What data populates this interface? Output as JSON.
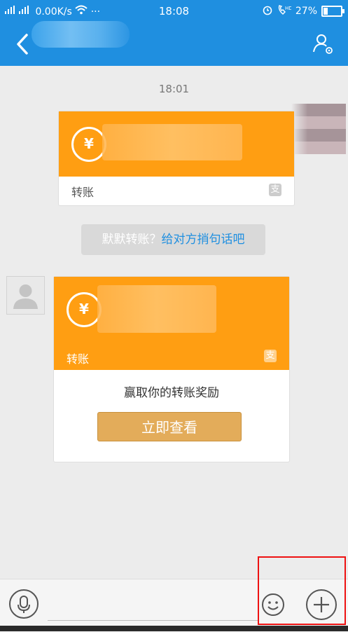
{
  "status_bar": {
    "network": "4G 2G",
    "speed": "0.00K/s",
    "time": "18:08",
    "battery_percent": "27%",
    "battery_level": 0.27
  },
  "chat": {
    "timestamp": "18:01",
    "sent_transfer": {
      "label": "转账",
      "coin_glyph": "¥"
    },
    "system_hint": {
      "prefix": "默默转账？",
      "link": "给对方捎句话吧"
    },
    "received_transfer": {
      "label": "转账",
      "coin_glyph": "¥",
      "reward_text": "赢取你的转账奖励",
      "button_label": "立即查看"
    }
  },
  "icons": {
    "back": "back-arrow-icon",
    "profile": "profile-settings-icon",
    "alipay": "alipay-logo-icon",
    "mic": "microphone-icon",
    "emoji": "emoji-icon",
    "plus": "plus-icon",
    "alarm": "alarm-icon",
    "call": "hd-call-icon",
    "wifi": "wifi-icon"
  },
  "colors": {
    "header": "#1f8fe0",
    "transfer_orange": "#ff9e12",
    "button_gold": "#e3ac5a",
    "link_blue": "#1f8fe0",
    "highlight_red": "#ee1111"
  }
}
